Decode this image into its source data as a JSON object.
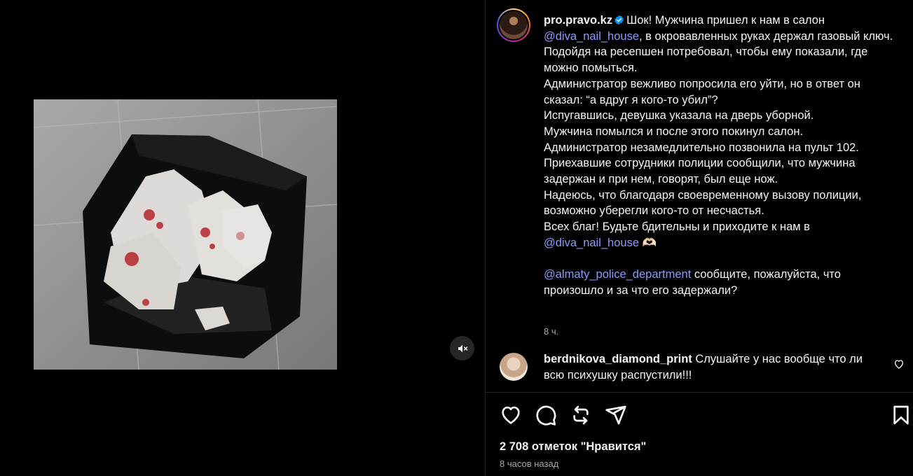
{
  "post": {
    "username": "pro.pravo.kz",
    "caption_lines": [
      [
        {
          "t": "Шок! Мужчина пришел к нам в салон "
        }
      ],
      [
        {
          "t": "@diva_nail_house",
          "m": true
        },
        {
          "t": ", в окровавленных руках держал газовый ключ."
        }
      ],
      [
        {
          "t": "Подойдя на ресепшен потребовал, чтобы ему показали, где можно помыться."
        }
      ],
      [
        {
          "t": "Администратор вежливо попросила его уйти, но в ответ он сказал: “а вдруг я кого-то убил”?"
        }
      ],
      [
        {
          "t": "Испугавшись, девушка указала на дверь уборной."
        }
      ],
      [
        {
          "t": "Мужчина помылся и после этого покинул салон."
        }
      ],
      [
        {
          "t": "Администратор незамедлительно позвонила на пульт 102."
        }
      ],
      [
        {
          "t": "Приехавшие сотрудники полиции сообщили, что мужчина задержан и при нем, говорят, был еще нож."
        }
      ],
      [
        {
          "t": "Надеюсь, что благодаря своевременному вызову полиции, возможно уберегли кого-то от несчастья."
        }
      ],
      [
        {
          "t": "Всех благ! Будьте бдительны и приходите к нам в "
        }
      ],
      [
        {
          "t": "@diva_nail_house",
          "m": true
        },
        {
          "t": " 🫶🏻"
        }
      ],
      [
        {
          "t": " "
        }
      ],
      [
        {
          "t": "@almaty_police_department",
          "m": true
        },
        {
          "t": " сообщите, пожалуйста, что произошло и за что его задержали?"
        }
      ]
    ],
    "time": "8 ч."
  },
  "comment": {
    "username": "berdnikova_diamond_print",
    "text": "Слушайте у нас вообще что ли всю психушку распустили!!!"
  },
  "stats": {
    "likes": "2 708 отметок \"Нравится\"",
    "date": "8 часов назад"
  },
  "icons": [
    "muted-speaker-icon",
    "verified-badge-icon",
    "heart-icon",
    "comment-icon",
    "repost-icon",
    "share-icon",
    "bookmark-icon"
  ],
  "colors": {
    "background": "#000000",
    "text": "#f5f5f5",
    "mention": "#8c9cf6",
    "muted": "#a8a8a8",
    "verified": "#0095f6"
  }
}
